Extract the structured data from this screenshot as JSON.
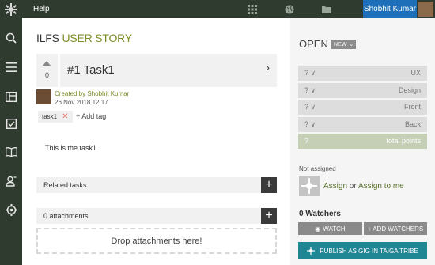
{
  "topbar": {
    "help_label": "Help",
    "user_name": "Shobhit Kumar",
    "icons": [
      "taiga-logo-icon",
      "grid-icon",
      "globe-icon",
      "folder-icon"
    ]
  },
  "sidebar": {
    "items": [
      "search-icon",
      "menu-icon",
      "kanban-icon",
      "backlog-icon",
      "wiki-icon",
      "team-icon",
      "settings-icon"
    ]
  },
  "story": {
    "project_name": "ILFS",
    "type_label": "USER STORY",
    "votes": "0",
    "subject": "#1 Task1",
    "created_by": "Created by Shobhit Kumar",
    "created_date": "26 Nov 2018 12:17",
    "tags": [
      {
        "label": "task1"
      }
    ],
    "add_tag_label": "+ Add tag",
    "description": "This is the task1",
    "related_tasks_label": "Related tasks",
    "attachments_label": "0 attachments",
    "drop_label": "Drop attachments here!"
  },
  "details": {
    "status": "OPEN",
    "status_badge": "NEW",
    "points": [
      {
        "value": "? ∨",
        "role": "UX"
      },
      {
        "value": "? ∨",
        "role": "Design"
      },
      {
        "value": "? ∨",
        "role": "Front"
      },
      {
        "value": "? ∨",
        "role": "Back"
      }
    ],
    "total_points": {
      "value": "?",
      "label": "total points"
    },
    "not_assigned_label": "Not assigned",
    "assign_label": "Assign",
    "or_label": "or",
    "assign_to_me_label": "Assign to me",
    "watchers_label": "0 Watchers",
    "watch_label": "WATCH",
    "add_watchers_label": "+ ADD WATCHERS",
    "publish_label": "PUBLISH AS GIG IN TAIGA TRIBE"
  },
  "colors": {
    "topbar_bg": "#2f3b2f",
    "accent_green": "#7b8f26",
    "user_blue": "#1c6fb8",
    "publish_teal": "#1f8794"
  }
}
